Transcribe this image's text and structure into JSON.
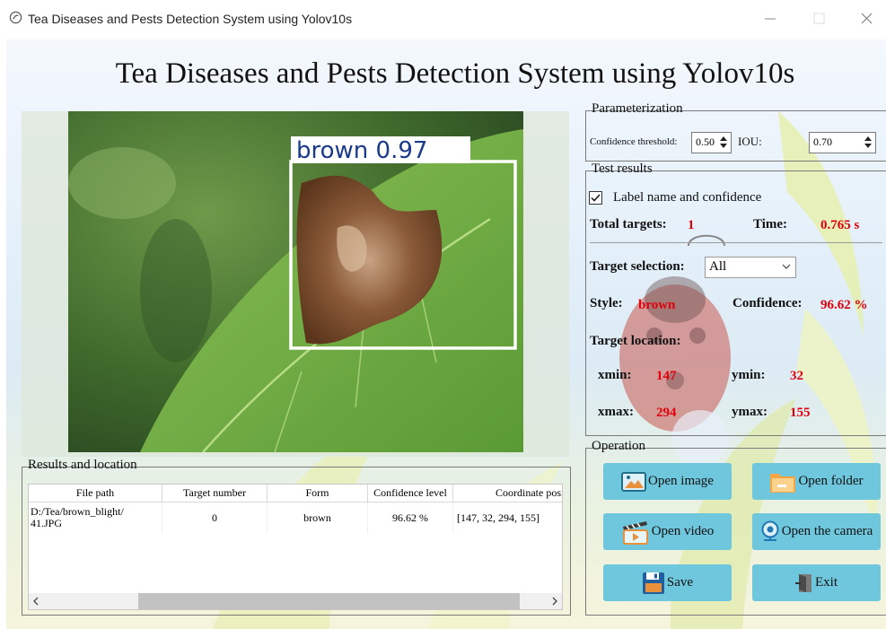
{
  "window": {
    "title": "Tea Diseases and Pests Detection System using Yolov10s"
  },
  "header": {
    "title": "Tea Diseases and Pests Detection System using Yolov10s"
  },
  "detection": {
    "label": "brown 0.97"
  },
  "params": {
    "group_label": "Parameterization",
    "confidence_label": "Confidence threshold:",
    "confidence_value": "0.50",
    "iou_label": "IOU:",
    "iou_value": "0.70"
  },
  "results": {
    "group_label": "Test results",
    "checkbox_label": "Label name and confidence",
    "checkbox_checked": true,
    "total_label": "Total targets:",
    "total_value": "1",
    "time_label": "Time:",
    "time_value": "0.765 s",
    "selection_label": "Target selection:",
    "selection_value": "All",
    "style_label": "Style:",
    "style_value": "brown",
    "confidence_label": "Confidence:",
    "confidence_value": "96.62 %",
    "location_label": "Target location:",
    "xmin_label": "xmin:",
    "xmin_value": "147",
    "ymin_label": "ymin:",
    "ymin_value": "32",
    "xmax_label": "xmax:",
    "xmax_value": "294",
    "ymax_label": "ymax:",
    "ymax_value": "155"
  },
  "operation": {
    "group_label": "Operation",
    "open_image": "Open image",
    "open_folder": "Open folder",
    "open_video": "Open video",
    "open_camera": "Open the camera",
    "save": "Save",
    "exit": "Exit"
  },
  "table": {
    "group_label": "Results and location",
    "headers": [
      "File path",
      "Target number",
      "Form",
      "Confidence level",
      "Coordinate positi"
    ],
    "rows": [
      [
        "D:/Tea/brown_blight/\n41.JPG",
        "0",
        "brown",
        "96.62 %",
        "[147, 32, 294, 155]"
      ]
    ]
  },
  "colors": {
    "accent_button": "#6ec7dc",
    "value_red": "#e0000c",
    "detection_box": "#ffffff"
  },
  "icons": [
    "app-icon",
    "minimize-icon",
    "maximize-icon",
    "close-icon",
    "image-icon",
    "folder-icon",
    "video-icon",
    "camera-icon",
    "save-icon",
    "exit-icon",
    "checkbox-check-icon",
    "chevron-down-icon",
    "scroll-left-icon",
    "scroll-right-icon"
  ]
}
